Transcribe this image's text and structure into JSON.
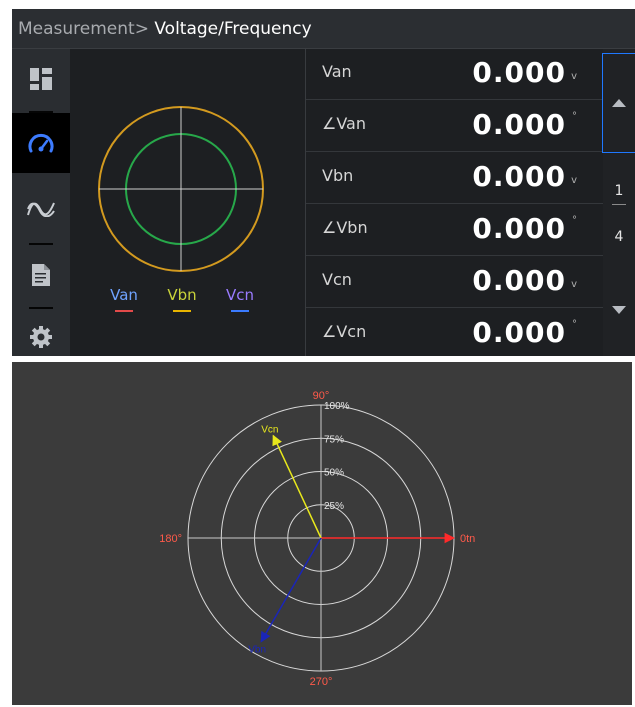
{
  "breadcrumb": {
    "root": "Measurement",
    "separator": ">",
    "current": "Voltage/Frequency"
  },
  "sidebar": {
    "items": [
      {
        "icon": "dashboard-icon",
        "active": false
      },
      {
        "icon": "gauge-icon",
        "active": true
      },
      {
        "icon": "waveform-icon",
        "active": false
      },
      {
        "icon": "document-icon",
        "active": false
      },
      {
        "icon": "gear-icon",
        "active": false
      }
    ]
  },
  "mini_phasor": {
    "legend": [
      {
        "label": "Van",
        "text_color": "#6fa3ff",
        "bar_color": "#e24a4a"
      },
      {
        "label": "Vbn",
        "text_color": "#c9d33a",
        "bar_color": "#e8b400"
      },
      {
        "label": "Vcn",
        "text_color": "#9a7bff",
        "bar_color": "#3b7bff"
      }
    ],
    "outer_circle_color": "#d39a1f",
    "inner_circle_color": "#27a84a"
  },
  "readings": [
    {
      "label": "Van",
      "value": "0.000",
      "unit": "v"
    },
    {
      "label": "∠Van",
      "value": "0.000",
      "unit": "°"
    },
    {
      "label": "Vbn",
      "value": "0.000",
      "unit": "v"
    },
    {
      "label": "∠Vbn",
      "value": "0.000",
      "unit": "°"
    },
    {
      "label": "Vcn",
      "value": "0.000",
      "unit": "v"
    },
    {
      "label": "∠Vcn",
      "value": "0.000",
      "unit": "°"
    }
  ],
  "pager": {
    "current_page": "1",
    "total_pages": "4"
  },
  "colors": {
    "accent": "#1f78ff",
    "panel_bg": "#1d1f22",
    "plot_bg": "#3b3b3b"
  },
  "chart_data": {
    "type": "polar",
    "title": "",
    "radial_ticks": [
      "25%",
      "50%",
      "75%",
      "100%"
    ],
    "radial_values": [
      25,
      50,
      75,
      100
    ],
    "angle_labels": [
      "0tn",
      "90°",
      "180°",
      "270°"
    ],
    "angle_values": [
      0,
      90,
      180,
      270
    ],
    "grid": true,
    "series": [
      {
        "name": "Van",
        "magnitude": 100,
        "angle": 0,
        "color": "#ff2a2a"
      },
      {
        "name": "Vcn",
        "magnitude": 85,
        "angle": 115,
        "color": "#e8e81c"
      },
      {
        "name": "Vbn",
        "magnitude": 90,
        "angle": 240,
        "color": "#1a25b8"
      }
    ]
  }
}
